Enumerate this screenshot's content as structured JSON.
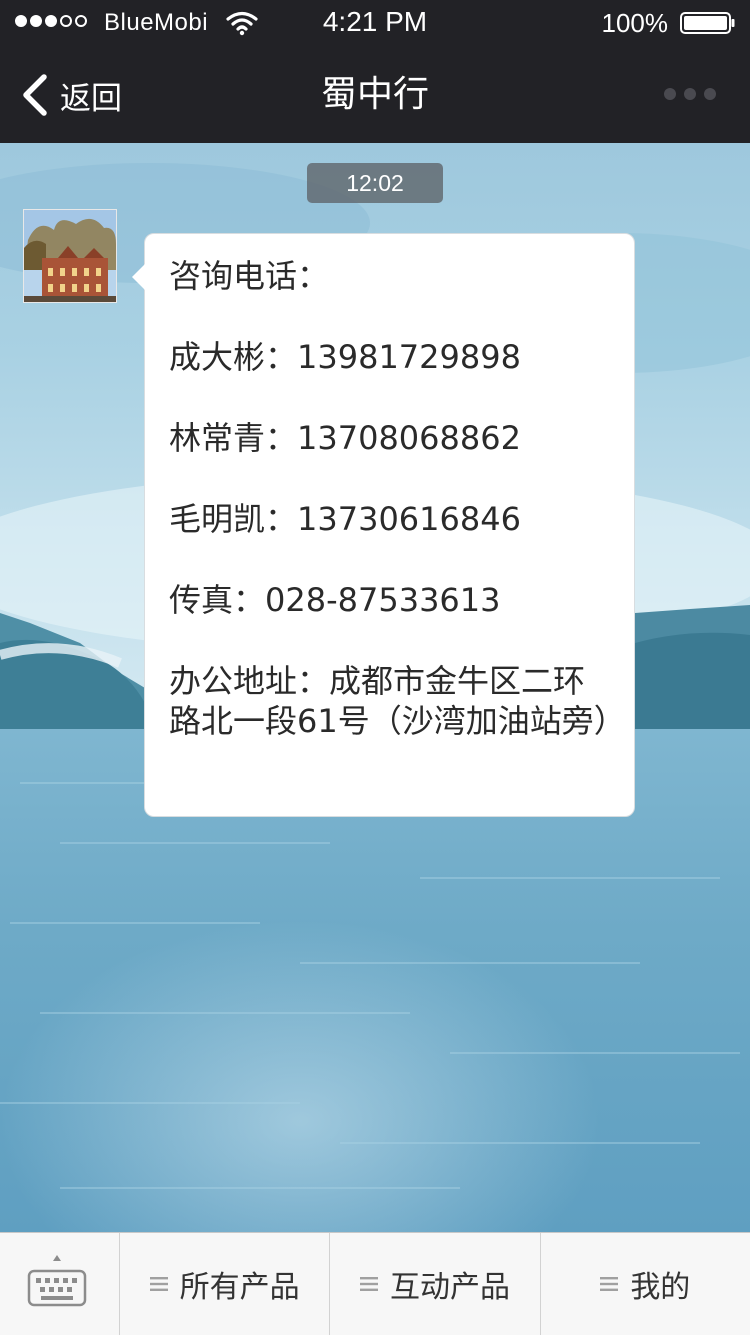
{
  "status_bar": {
    "carrier": "BlueMobi",
    "time": "4:21 PM",
    "battery": "100%",
    "signal_bars_filled": 3,
    "signal_bars_total": 5,
    "battery_level": 1.0
  },
  "nav": {
    "back_label": "返回",
    "title": "蜀中行",
    "back_icon": "chevron-left-icon",
    "more_icon": "more-dots-icon"
  },
  "chat": {
    "timestamp": "12:02",
    "message": {
      "lines": [
        "咨询电话：",
        "成大彬：13981729898",
        "林常青：13708068862",
        "毛明凯：13730616846",
        "传真：028-87533613",
        "办公地址：成都市金牛区二环路北一段61号（沙湾加油站旁）"
      ]
    }
  },
  "tab_bar": {
    "keyboard_icon": "keyboard-icon",
    "items": [
      {
        "label": "所有产品",
        "icon": "menu-icon"
      },
      {
        "label": "互动产品",
        "icon": "menu-icon"
      },
      {
        "label": "我的",
        "icon": "menu-icon"
      }
    ]
  },
  "colors": {
    "header_bg": "#222226",
    "bubble_bg": "#ffffff",
    "tab_bar_bg": "#f7f7f7",
    "sea": "#7fb6d0"
  }
}
